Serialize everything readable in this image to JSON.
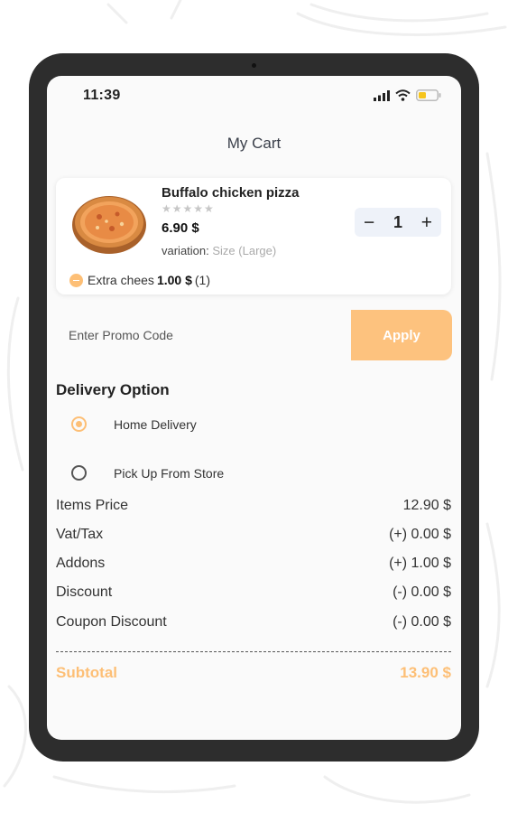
{
  "status": {
    "time": "11:39"
  },
  "page_title": "My Cart",
  "cart_item": {
    "name": "Buffalo chicken pizza",
    "rating": "★★★★★",
    "price": "6.90 $",
    "variation_label": "variation:",
    "variation_value": "Size (Large)",
    "quantity": "1",
    "minus": "−",
    "plus": "+",
    "addon": {
      "name": "Extra chees",
      "price": "1.00 $",
      "count": "(1)"
    }
  },
  "promo": {
    "placeholder": "Enter Promo Code",
    "button": "Apply"
  },
  "delivery": {
    "title": "Delivery Option",
    "options": [
      {
        "label": "Home Delivery",
        "selected": true
      },
      {
        "label": "Pick Up From Store",
        "selected": false
      }
    ]
  },
  "summary": [
    {
      "label": "Items Price",
      "value": "12.90 $"
    },
    {
      "label": "Vat/Tax",
      "value": "(+) 0.00 $"
    },
    {
      "label": "Addons",
      "value": "(+) 1.00 $"
    },
    {
      "label": "Discount",
      "value": "(-) 0.00 $"
    },
    {
      "label": "Coupon Discount",
      "value": "(-) 0.00 $"
    }
  ],
  "subtotal": {
    "label": "Subtotal",
    "value": "13.90 $"
  },
  "colors": {
    "accent": "#fdbf76",
    "apply_button": "#fdc27e",
    "device_frame": "#2d2d2d",
    "screen_bg": "#fafafa"
  },
  "icons": [
    "signal-icon",
    "wifi-icon",
    "battery-icon",
    "minus-icon",
    "plus-icon",
    "radio-selected-icon",
    "radio-unselected-icon"
  ]
}
